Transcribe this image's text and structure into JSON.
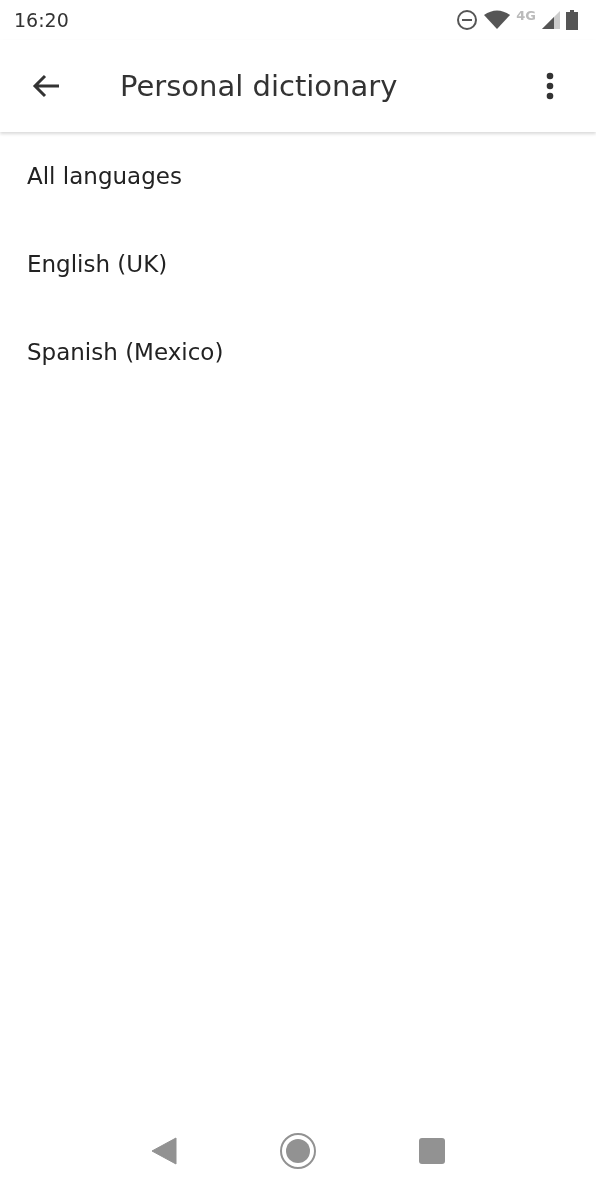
{
  "status_bar": {
    "time": "16:20",
    "network": "4G"
  },
  "app_bar": {
    "title": "Personal dictionary"
  },
  "languages": [
    {
      "label": "All languages"
    },
    {
      "label": "English (UK)"
    },
    {
      "label": "Spanish (Mexico)"
    }
  ]
}
